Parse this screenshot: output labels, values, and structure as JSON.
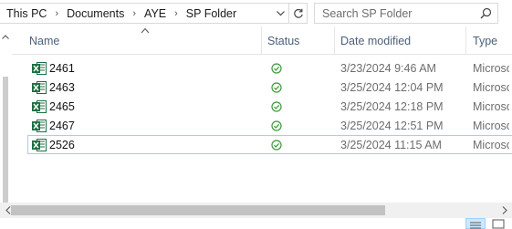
{
  "address_bar": {
    "crumbs": [
      "This PC",
      "Documents",
      "AYE",
      "SP Folder"
    ],
    "search_placeholder": "Search SP Folder"
  },
  "columns": {
    "name": "Name",
    "status": "Status",
    "date_modified": "Date modified",
    "type": "Type"
  },
  "files": [
    {
      "name": "2461",
      "date": "3/23/2024 9:46 AM",
      "type": "Microso"
    },
    {
      "name": "2463",
      "date": "3/25/2024 12:04 PM",
      "type": "Microso"
    },
    {
      "name": "2465",
      "date": "3/25/2024 12:18 PM",
      "type": "Microso"
    },
    {
      "name": "2467",
      "date": "3/25/2024 12:51 PM",
      "type": "Microso"
    },
    {
      "name": "2526",
      "date": "3/25/2024 11:15 AM",
      "type": "Microso"
    }
  ],
  "colors": {
    "excel_green": "#1d6f42",
    "status_green": "#3a9a3a",
    "selection_border": "#99d1ff"
  },
  "icons": {
    "file": "excel-file-icon",
    "status": "available-status-icon",
    "search": "search-icon",
    "refresh": "refresh-icon"
  }
}
